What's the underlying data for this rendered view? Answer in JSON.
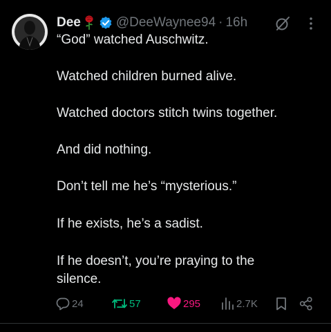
{
  "tweet": {
    "author": {
      "name": "Dee",
      "handle": "@DeeWaynee94",
      "separator": "·",
      "time": "16h"
    },
    "lines": [
      "“God” watched Auschwitz.",
      "Watched children burned alive.",
      "Watched doctors stitch twins together.",
      "And did nothing.",
      "Don’t tell me he’s “mysterious.”",
      "If he exists, he’s a sadist.",
      "If he doesn’t, you’re praying to the",
      "silence."
    ],
    "stats": {
      "replies": "24",
      "reposts": "57",
      "likes": "295",
      "views": "2.7K"
    }
  },
  "icons": {
    "avatar": "avatar-photo",
    "name_emoji": "rose-icon",
    "verified": "verified-badge-icon",
    "grok": "grok-icon",
    "more": "more-icon",
    "reply": "reply-icon",
    "repost": "repost-icon",
    "like": "heart-icon",
    "views": "views-icon",
    "bookmark": "bookmark-icon",
    "share": "share-icon"
  },
  "colors": {
    "background": "#000000",
    "text": "#e7e9ea",
    "muted": "#71767b",
    "verified": "#1d9bf0",
    "repost": "#00ba7c",
    "like": "#f91880"
  }
}
